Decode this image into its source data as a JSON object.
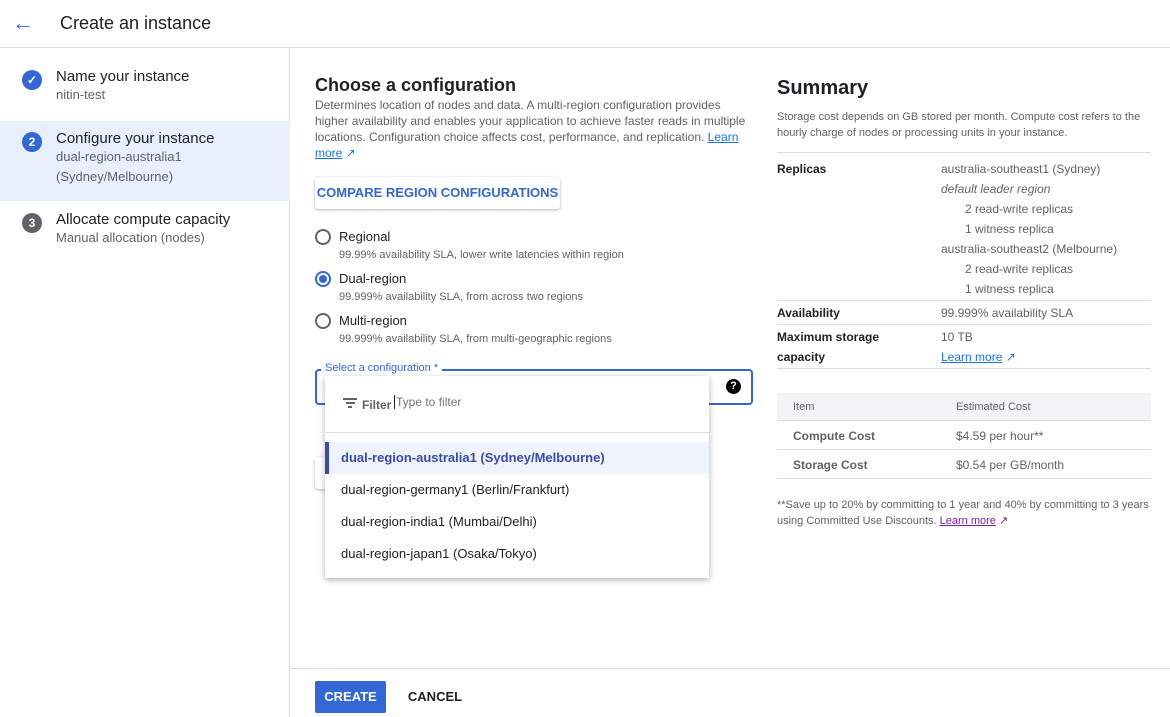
{
  "header": {
    "title": "Create an instance",
    "back_icon": "arrow-back-icon"
  },
  "steps": [
    {
      "number": "✓",
      "title": "Name your instance",
      "subtitle": "nitin-test",
      "status": "done"
    },
    {
      "number": "2",
      "title": "Configure your instance",
      "subtitle": "dual-region-australia1 (Sydney/Melbourne)",
      "status": "active"
    },
    {
      "number": "3",
      "title": "Allocate compute capacity",
      "subtitle": "Manual allocation (nodes)",
      "status": "pending"
    }
  ],
  "config": {
    "title": "Choose a configuration",
    "description": "Determines location of nodes and data. A multi-region configuration provides higher availability and enables your application to achieve faster reads in multiple locations. Configuration choice affects cost, performance, and replication.",
    "learn_more": "Learn more",
    "compare_button": "COMPARE REGION CONFIGURATIONS",
    "options": [
      {
        "label": "Regional",
        "desc": "99.99% availability SLA, lower write latencies within region",
        "selected": false
      },
      {
        "label": "Dual-region",
        "desc": "99.999% availability SLA, from across two regions",
        "selected": true
      },
      {
        "label": "Multi-region",
        "desc": "99.999% availability SLA, from multi-geographic regions",
        "selected": false
      }
    ],
    "select_label": "Select a configuration *",
    "filter_label": "Filter",
    "filter_placeholder": "Type to filter",
    "dropdown": [
      "dual-region-australia1 (Sydney/Melbourne)",
      "dual-region-germany1 (Berlin/Frankfurt)",
      "dual-region-india1 (Mumbai/Delhi)",
      "dual-region-japan1 (Osaka/Tokyo)"
    ]
  },
  "summary": {
    "title": "Summary",
    "description": "Storage cost depends on GB stored per month. Compute cost refers to the hourly charge of nodes or processing units in your instance.",
    "replicas_label": "Replicas",
    "replicas": [
      "australia-southeast1 (Sydney)",
      "default leader region",
      "2 read-write replicas",
      "1 witness replica",
      "australia-southeast2 (Melbourne)",
      "2 read-write replicas",
      "1 witness replica"
    ],
    "availability_label": "Availability",
    "availability": "99.999% availability SLA",
    "storage_label_1": "Maximum storage",
    "storage_label_2": "capacity",
    "storage": "10 TB",
    "learn_more": "Learn more",
    "table": {
      "headers": [
        "Item",
        "Estimated Cost"
      ],
      "rows": [
        [
          "Compute Cost",
          "$4.59 per hour**"
        ],
        [
          "Storage Cost",
          "$0.54 per GB/month"
        ]
      ]
    },
    "note": "**Save up to 20% by committing to 1 year and 40% by committing to 3 years using Committed Use Discounts.",
    "note_link": "Learn more"
  },
  "footer": {
    "create": "CREATE",
    "cancel": "CANCEL"
  },
  "colors": {
    "accent": "#3367d6",
    "active_step_bg": "#e8f0fe"
  }
}
